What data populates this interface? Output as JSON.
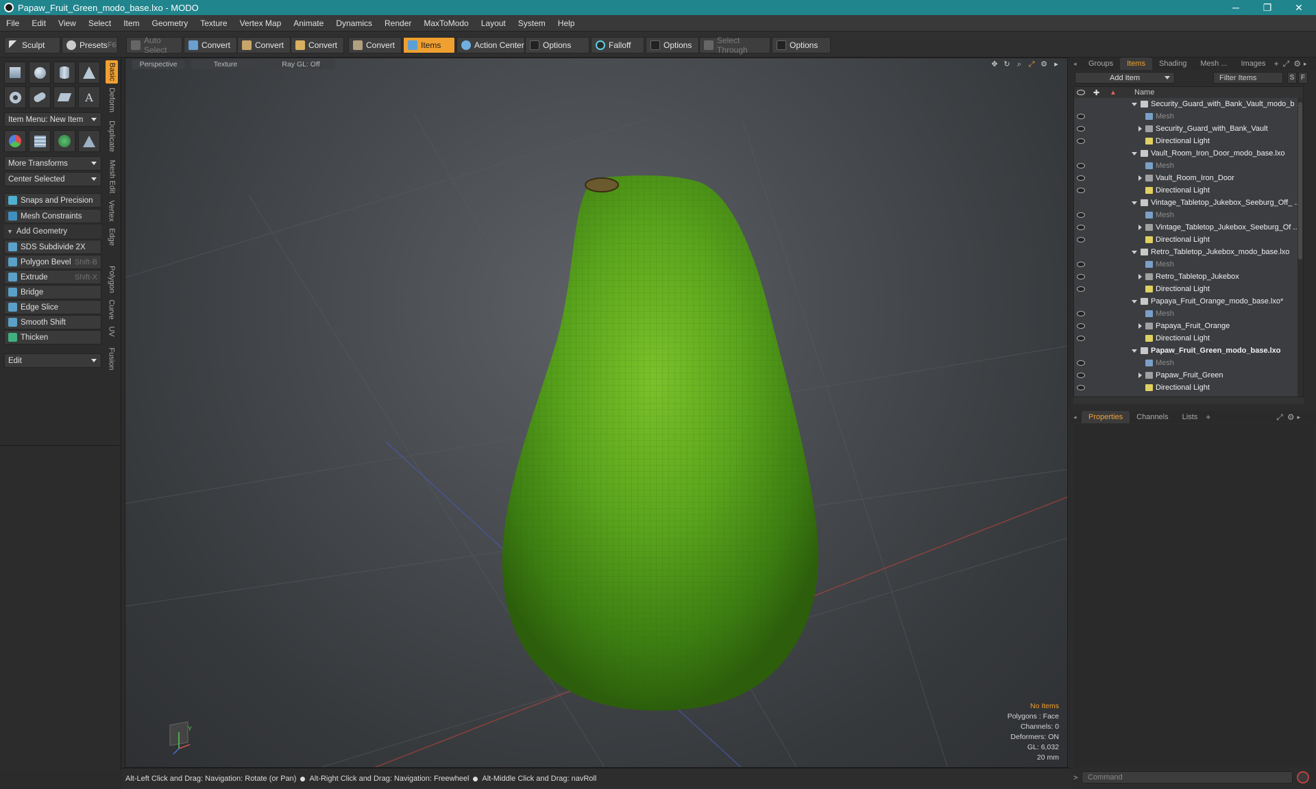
{
  "window": {
    "title": "Papaw_Fruit_Green_modo_base.lxo - MODO",
    "minimize": "─",
    "maximize": "❐",
    "close": "✕"
  },
  "menubar": [
    "File",
    "Edit",
    "View",
    "Select",
    "Item",
    "Geometry",
    "Texture",
    "Vertex Map",
    "Animate",
    "Dynamics",
    "Render",
    "MaxToModo",
    "Layout",
    "System",
    "Help"
  ],
  "toolbar": {
    "sculpt": "Sculpt",
    "presets": "Presets",
    "presets_key": "F6",
    "auto_select": "Auto Select",
    "convert1": "Convert",
    "convert2": "Convert",
    "convert3": "Convert",
    "convert4": "Convert",
    "items": "Items",
    "action_center": "Action Center",
    "options1": "Options",
    "falloff": "Falloff",
    "options2": "Options",
    "select_through": "Select Through",
    "options3": "Options"
  },
  "left": {
    "item_menu": "Item Menu: New Item",
    "more_transforms": "More Transforms",
    "center_selected": "Center Selected",
    "snaps": "Snaps and Precision",
    "mesh_constraints": "Mesh Constraints",
    "add_geometry": "Add Geometry",
    "tools": [
      {
        "label": "SDS Subdivide 2X",
        "key": ""
      },
      {
        "label": "Polygon Bevel",
        "key": "Shift-B"
      },
      {
        "label": "Extrude",
        "key": "Shift-X"
      },
      {
        "label": "Bridge",
        "key": ""
      },
      {
        "label": "Edge Slice",
        "key": ""
      },
      {
        "label": "Smooth Shift",
        "key": ""
      },
      {
        "label": "Thicken",
        "key": ""
      }
    ],
    "edit": "Edit",
    "vtabs": [
      "Basic",
      "Deform",
      "Duplicate",
      "Mesh Edit",
      "Vertex",
      "Edge",
      "Polygon",
      "Curve",
      "UV",
      "Fusion"
    ]
  },
  "viewport": {
    "perspective": "Perspective",
    "texture": "Texture",
    "raygl": "Ray GL: Off",
    "hud": {
      "items": "No Items",
      "polygons": "Polygons : Face",
      "channels": "Channels: 0",
      "deformers": "Deformers: ON",
      "gl": "GL: 6,032",
      "scale": "20 mm"
    },
    "axis_y": "Y"
  },
  "status": {
    "hint1": "Alt-Left Click and Drag: Navigation: Rotate (or Pan)",
    "hint2": "Alt-Right Click and Drag: Navigation: Freewheel",
    "hint3": "Alt-Middle Click and Drag: navRoll"
  },
  "right": {
    "tabs": [
      "Groups",
      "Items",
      "Shading",
      "Mesh ...",
      "Images"
    ],
    "add_item": "Add Item",
    "filter": "Filter Items",
    "filter_s": "S",
    "filter_f": "F",
    "col_name": "Name",
    "tree": [
      {
        "label": "Security_Guard_with_Bank_Vault_modo_b ...",
        "type": "scene",
        "indent": 0
      },
      {
        "label": "Mesh",
        "type": "mesh",
        "indent": 2
      },
      {
        "label": "Security_Guard_with_Bank_Vault",
        "type": "group",
        "indent": 1
      },
      {
        "label": "Directional Light",
        "type": "light",
        "indent": 2
      },
      {
        "label": "Vault_Room_Iron_Door_modo_base.lxo",
        "type": "scene",
        "indent": 0
      },
      {
        "label": "Mesh",
        "type": "mesh",
        "indent": 2
      },
      {
        "label": "Vault_Room_Iron_Door",
        "type": "group",
        "indent": 1
      },
      {
        "label": "Directional Light",
        "type": "light",
        "indent": 2
      },
      {
        "label": "Vintage_Tabletop_Jukebox_Seeburg_Off_ ...",
        "type": "scene",
        "indent": 0
      },
      {
        "label": "Mesh",
        "type": "mesh",
        "indent": 2
      },
      {
        "label": "Vintage_Tabletop_Jukebox_Seeburg_Of ...",
        "type": "group",
        "indent": 1
      },
      {
        "label": "Directional Light",
        "type": "light",
        "indent": 2
      },
      {
        "label": "Retro_Tabletop_Jukebox_modo_base.lxo",
        "type": "scene",
        "indent": 0
      },
      {
        "label": "Mesh",
        "type": "mesh",
        "indent": 2
      },
      {
        "label": "Retro_Tabletop_Jukebox",
        "type": "group",
        "indent": 1
      },
      {
        "label": "Directional Light",
        "type": "light",
        "indent": 2
      },
      {
        "label": "Papaya_Fruit_Orange_modo_base.lxo*",
        "type": "scene",
        "indent": 0
      },
      {
        "label": "Mesh",
        "type": "mesh",
        "indent": 2
      },
      {
        "label": "Papaya_Fruit_Orange",
        "type": "group",
        "indent": 1
      },
      {
        "label": "Directional Light",
        "type": "light",
        "indent": 2
      },
      {
        "label": "Papaw_Fruit_Green_modo_base.lxo",
        "type": "scene",
        "indent": 0,
        "bold": true
      },
      {
        "label": "Mesh",
        "type": "mesh",
        "indent": 2
      },
      {
        "label": "Papaw_Fruit_Green",
        "type": "group",
        "indent": 1
      },
      {
        "label": "Directional Light",
        "type": "light",
        "indent": 2
      }
    ],
    "prop_tabs": [
      "Properties",
      "Channels",
      "Lists"
    ],
    "command": "Command"
  },
  "colors": {
    "accent": "#f0a030",
    "titlebar": "#20858d",
    "fruit": "#5aa51d"
  }
}
